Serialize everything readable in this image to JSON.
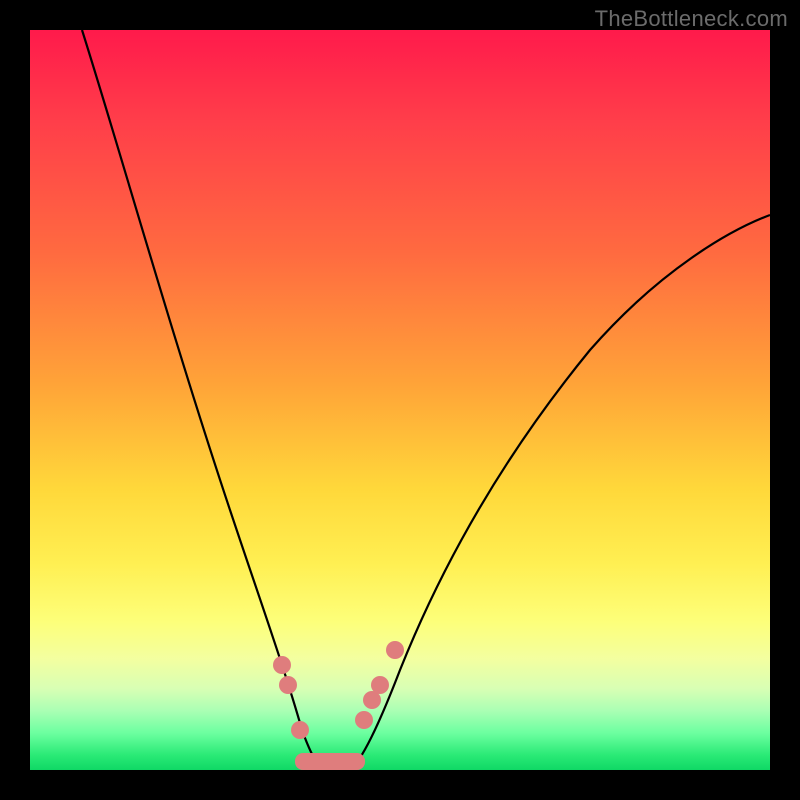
{
  "watermark": "TheBottleneck.com",
  "chart_data": {
    "type": "line",
    "title": "",
    "xlabel": "",
    "ylabel": "",
    "xlim": [
      0,
      100
    ],
    "ylim": [
      0,
      100
    ],
    "series": [
      {
        "name": "left-curve",
        "x": [
          7,
          10,
          14,
          18,
          22,
          26,
          29,
          32,
          34,
          36,
          38
        ],
        "y": [
          100,
          80,
          60,
          44,
          32,
          22,
          14,
          8,
          4,
          1,
          0
        ]
      },
      {
        "name": "right-curve",
        "x": [
          42,
          44,
          48,
          54,
          62,
          72,
          84,
          100
        ],
        "y": [
          0,
          2,
          8,
          18,
          32,
          48,
          62,
          75
        ]
      },
      {
        "name": "valley-floor",
        "x": [
          38,
          40,
          42
        ],
        "y": [
          0,
          0,
          0
        ]
      }
    ],
    "markers": {
      "name": "highlight-dots",
      "color": "#e57373",
      "points": [
        {
          "x": 33,
          "y": 14
        },
        {
          "x": 34,
          "y": 11
        },
        {
          "x": 36,
          "y": 5
        },
        {
          "x": 44,
          "y": 7
        },
        {
          "x": 45,
          "y": 10
        },
        {
          "x": 46,
          "y": 12
        },
        {
          "x": 48,
          "y": 17
        }
      ]
    },
    "valley_band": {
      "color": "#e57373",
      "x_from": 35,
      "x_to": 43,
      "y": 0,
      "thickness_pct": 2.2
    }
  }
}
